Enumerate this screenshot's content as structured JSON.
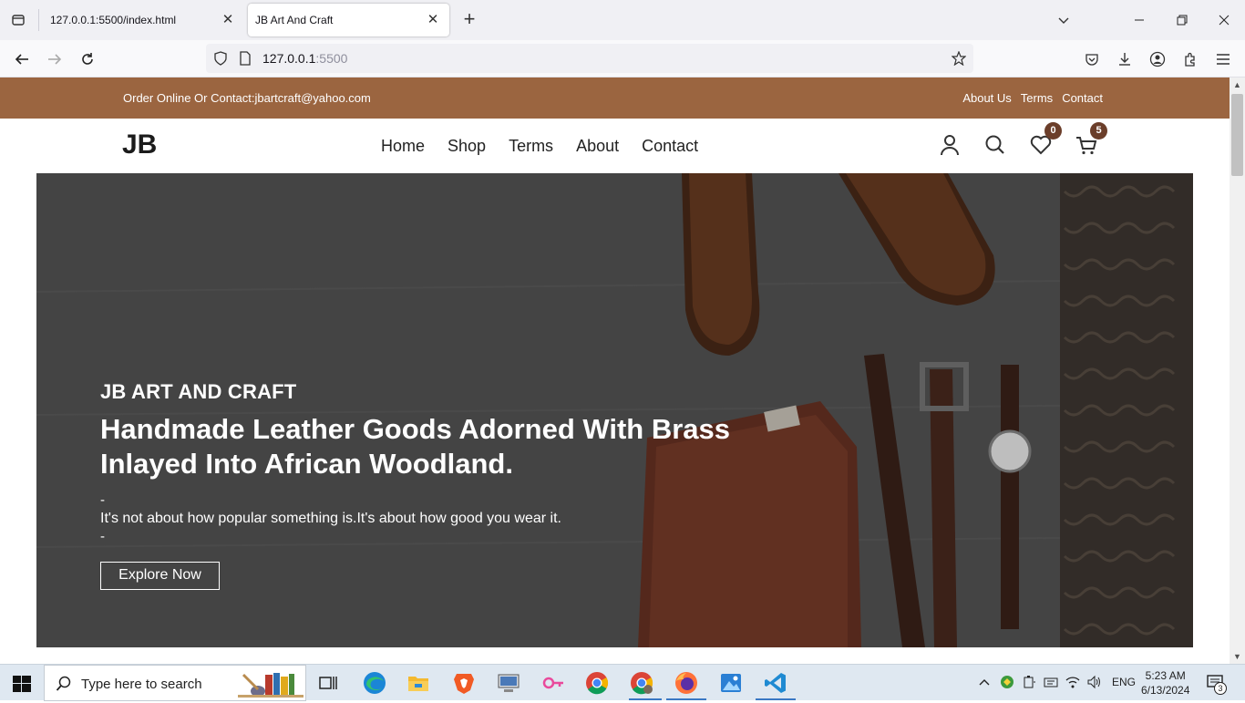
{
  "browser": {
    "tabs": [
      {
        "title": "127.0.0.1:5500/index.html",
        "active": false
      },
      {
        "title": "JB Art And Craft",
        "active": true
      }
    ],
    "url_host": "127.0.0.1",
    "url_port": ":5500"
  },
  "site": {
    "topbar": {
      "contact_text": "Order Online Or Contact:jbartcraft@yahoo.com",
      "links": [
        "About Us",
        "Terms",
        "Contact"
      ]
    },
    "logo": "JB",
    "nav": [
      "Home",
      "Shop",
      "Terms",
      "About",
      "Contact"
    ],
    "wishlist_count": "0",
    "cart_count": "5",
    "hero": {
      "kicker": "JB ART AND CRAFT",
      "title": "Handmade Leather Goods Adorned With Brass Inlayed Into African Woodland.",
      "dash": "-",
      "text": "It's not about how popular something is.It's about how good you wear it.",
      "button": "Explore Now"
    }
  },
  "taskbar": {
    "search_placeholder": "Type here to search",
    "lang": "ENG",
    "time": "5:23 AM",
    "date": "6/13/2024",
    "notifications": "3"
  },
  "colors": {
    "topbar": "#9b6540",
    "badge": "#6b3e2a"
  }
}
